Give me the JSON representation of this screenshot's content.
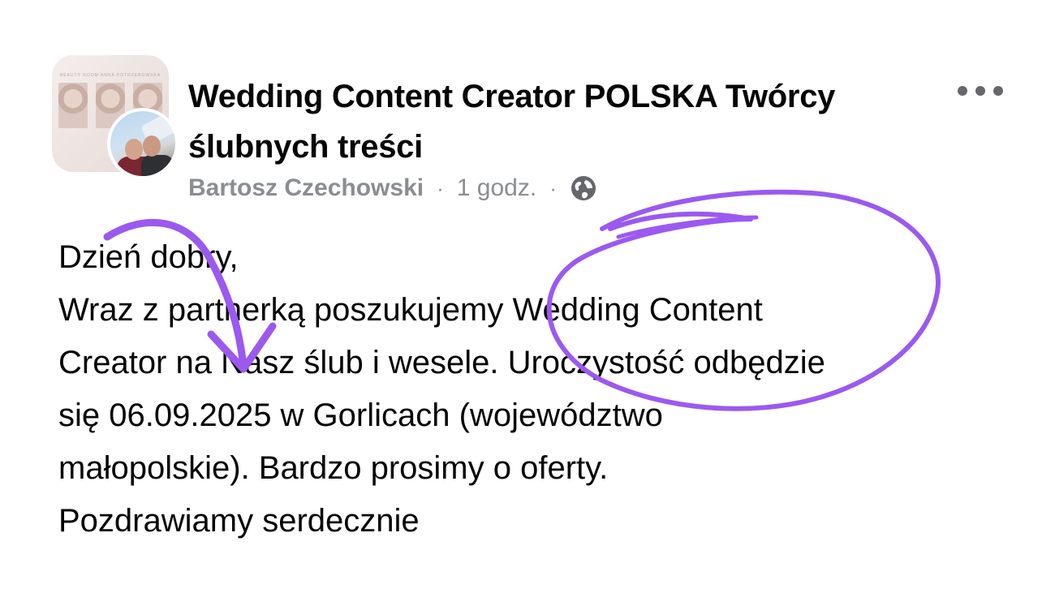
{
  "header": {
    "group_name_line1": "Wedding Content Creator POLSKA Twórcy",
    "group_name_line2": "ślubnych treści",
    "author": "Bartosz Czechowski",
    "separator": "·",
    "time": "1 godz.",
    "privacy_icon": "globe-icon",
    "more_icon": "more-horizontal-icon"
  },
  "group_avatar": {
    "banner": "BEAUTY ROOM ANNA POTRZEBOWSKA"
  },
  "post": {
    "lines": [
      "Dzień dobry,",
      "Wraz z partnerką poszukujemy Wedding Content",
      "Creator na Nasz ślub i wesele. Uroczystość odbędzie",
      "się 06.09.2025 w Gorlicach (województwo",
      "małopolskie). Bardzo prosimy o oferty.",
      "Pozdrawiamy serdecznie"
    ]
  },
  "annotations": {
    "color": "#9b59f0",
    "shapes": [
      "curved-arrow",
      "circle-highlight"
    ]
  }
}
